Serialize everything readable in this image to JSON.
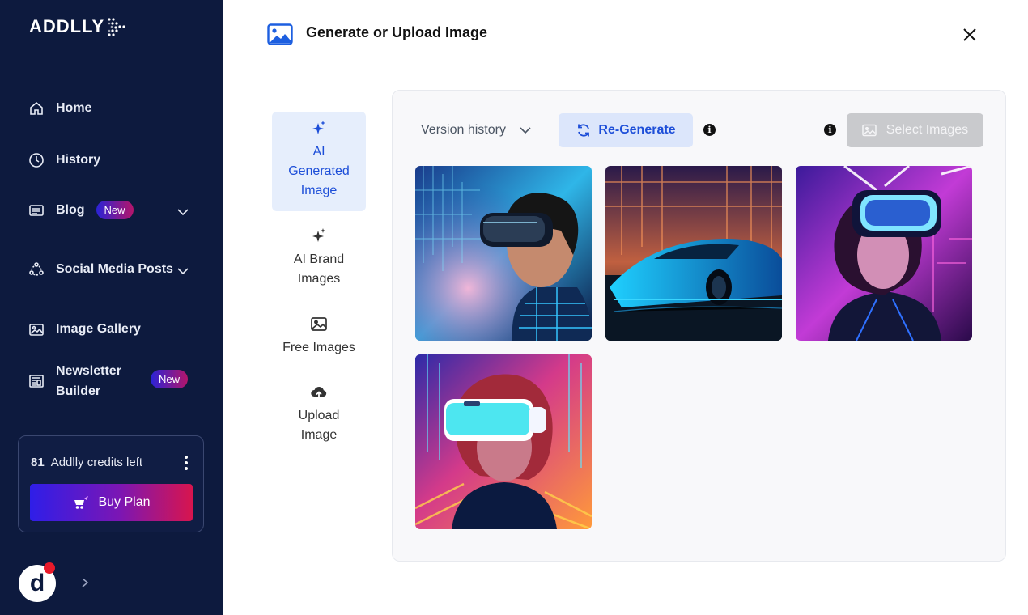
{
  "sidebar": {
    "logo_text": "ADDLLY",
    "items": [
      {
        "label": "Home"
      },
      {
        "label": "History"
      },
      {
        "label": "Blog",
        "badge": "New"
      },
      {
        "label": "Social Media Posts"
      },
      {
        "label": "Image Gallery"
      },
      {
        "label": "Newsletter Builder",
        "line1": "Newsletter",
        "line2": "Builder",
        "badge": "New"
      }
    ],
    "credits": {
      "count": "81",
      "label": "Addlly credits left"
    },
    "buy_label": "Buy Plan",
    "avatar_letter": "d"
  },
  "header": {
    "title": "Generate or Upload Image"
  },
  "tabs": [
    {
      "label": "AI Generated Image",
      "lines": [
        "AI",
        "Generated",
        "Image"
      ],
      "active": true
    },
    {
      "label": "AI Brand Images",
      "lines": [
        "AI Brand",
        "Images"
      ]
    },
    {
      "label": "Free Images",
      "lines": [
        "Free Images"
      ]
    },
    {
      "label": "Upload Image",
      "lines": [
        "Upload",
        "Image"
      ]
    }
  ],
  "toolbar": {
    "version_label": "Version history",
    "regenerate_label": "Re-Generate",
    "select_label": "Select Images",
    "info_glyph": "i"
  },
  "gallery": {
    "images": [
      {
        "icon": "vr-man-portrait"
      },
      {
        "icon": "futuristic-car"
      },
      {
        "icon": "vr-woman-neon"
      },
      {
        "icon": "vr-woman-cyberpunk"
      }
    ]
  },
  "colors": {
    "sidebar_bg": "#0d1a3e",
    "accent_blue": "#1d4ed8",
    "badge_gradient_start": "#2a23d6",
    "badge_gradient_end": "#b4156a"
  }
}
